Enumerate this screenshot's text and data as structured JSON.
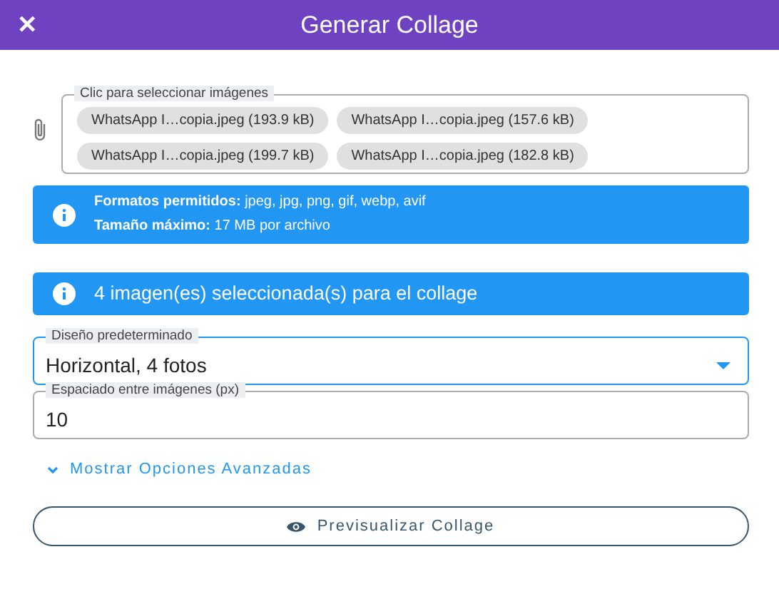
{
  "header": {
    "close": "✕",
    "title": "Generar Collage"
  },
  "file_field": {
    "label": "Clic para seleccionar imágenes",
    "files": [
      {
        "name": "WhatsApp I…copia.jpeg (193.9 kB)"
      },
      {
        "name": "WhatsApp I…copia.jpeg (157.6 kB)"
      },
      {
        "name": "WhatsApp I…copia.jpeg (199.7 kB)"
      },
      {
        "name": "WhatsApp I…copia.jpeg (182.8 kB)"
      }
    ]
  },
  "alerts": [
    {
      "kind": "small",
      "lines": [
        "**Formatos permitidos:** jpeg, jpg, png, gif, webp, avif",
        "**Tamaño máximo:** 17 MB por archivo"
      ]
    },
    {
      "kind": "large",
      "lines": [
        "4 imagen(es) seleccionada(s) para el collage"
      ]
    }
  ],
  "layout_select": {
    "label": "Diseño predeterminado",
    "value": "Horizontal, 4 fotos",
    "focused": true
  },
  "spacing_field": {
    "label": "Espaciado entre imágenes (px)",
    "value": "10"
  },
  "advanced_toggle": {
    "label": "Mostrar Opciones Avanzadas",
    "expanded": false
  },
  "preview_button": {
    "label": "Previsualizar Collage"
  }
}
